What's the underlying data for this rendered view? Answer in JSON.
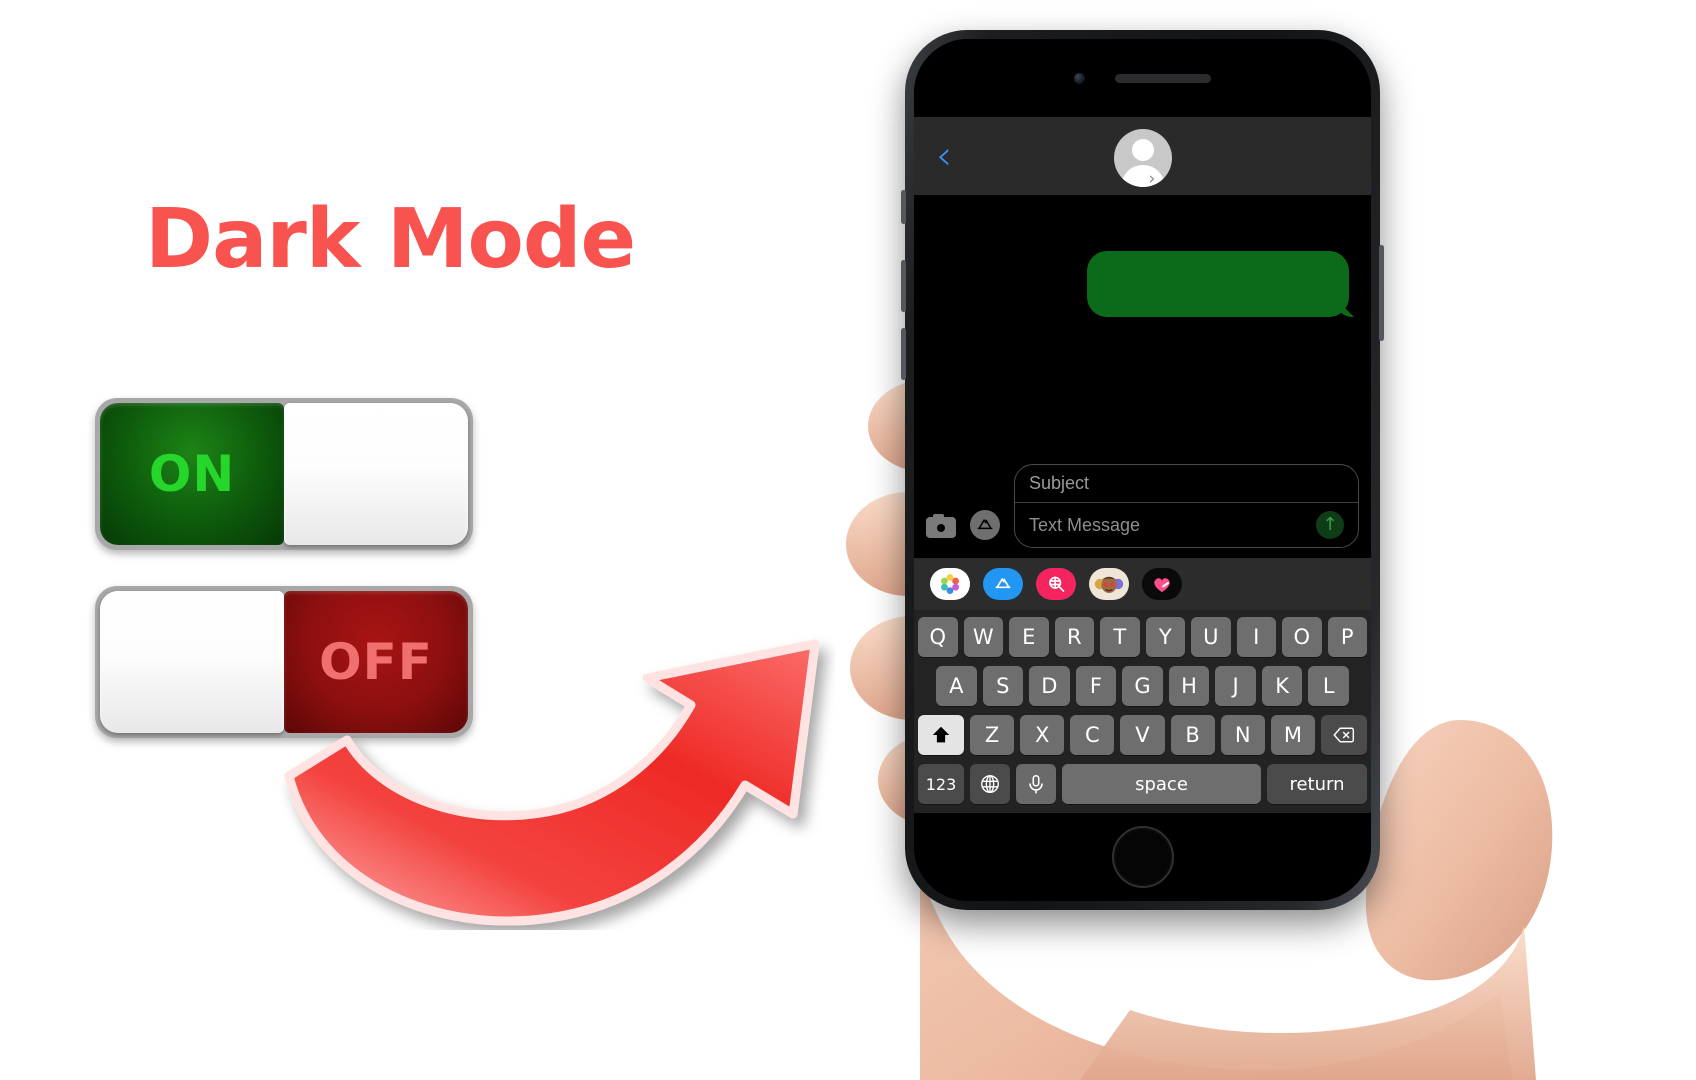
{
  "headline": {
    "text": "Dark Mode",
    "color": "#f9534f"
  },
  "toggles": {
    "on_switch": {
      "label": "ON",
      "state": "on",
      "color": "#0d5a0c",
      "text_color": "#27d62b"
    },
    "off_switch": {
      "label": "OFF",
      "state": "off",
      "color": "#8c0f0f",
      "text_color": "#f07070"
    }
  },
  "arrow": {
    "name": "curved-arrow",
    "color": "#f0312e",
    "points_to": "phone"
  },
  "phone": {
    "nav": {
      "back_icon": "chevron-left-icon",
      "back_color": "#3d90ff",
      "avatar_icon": "contact-avatar-icon",
      "detail_chevron": "›"
    },
    "thread": {
      "bubbles": [
        {
          "sender": "outgoing",
          "text": "",
          "color": "#0b6b1b",
          "type": "sms"
        }
      ]
    },
    "input_bar": {
      "camera_icon": "camera-icon",
      "apps_icon": "app-store-icon",
      "subject_placeholder": "Subject",
      "subject_value": "",
      "message_placeholder": "Text Message",
      "message_value": "",
      "send_icon": "arrow-up-icon",
      "send_color": "#0f3d18"
    },
    "app_drawer": [
      {
        "name": "photos-app-icon",
        "label": "Photos"
      },
      {
        "name": "app-store-app-icon",
        "label": "App Store"
      },
      {
        "name": "images-search-app-icon",
        "label": "#images"
      },
      {
        "name": "memoji-app-icon",
        "label": "Memoji Stickers"
      },
      {
        "name": "digital-touch-app-icon",
        "label": "Digital Touch"
      }
    ],
    "keyboard": {
      "row1": [
        "Q",
        "W",
        "E",
        "R",
        "T",
        "Y",
        "U",
        "I",
        "O",
        "P"
      ],
      "row2": [
        "A",
        "S",
        "D",
        "F",
        "G",
        "H",
        "J",
        "K",
        "L"
      ],
      "row3": [
        "Z",
        "X",
        "C",
        "V",
        "B",
        "N",
        "M"
      ],
      "shift_icon": "shift-icon",
      "shift_active": true,
      "delete_icon": "backspace-icon",
      "numbers_key": "123",
      "globe_icon": "globe-icon",
      "mic_icon": "microphone-icon",
      "space_key": "space",
      "return_key": "return"
    },
    "home_button": "home-button"
  }
}
